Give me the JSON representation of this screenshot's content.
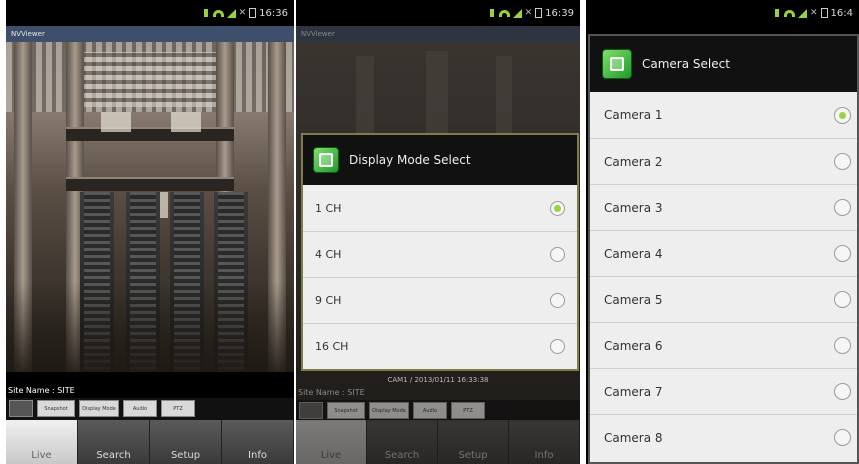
{
  "status": {
    "s1_time": "16:36",
    "s2_time": "16:39",
    "s3_time": "16:4"
  },
  "s1": {
    "app_title": "NVViewer",
    "site_name": "Site Name : SITE",
    "buttons": [
      "",
      "Snapshot",
      "Display Mode",
      "Audio",
      "PTZ"
    ],
    "tabs": [
      "Live",
      "Search",
      "Setup",
      "Info"
    ]
  },
  "s2": {
    "app_title": "NVViewer",
    "dialog_title": "Display Mode Select",
    "options": [
      "1 CH",
      "4 CH",
      "9 CH",
      "16 CH"
    ],
    "selected_index": 0,
    "cam_info": "CAM1 / 2013/01/11 16:33:38",
    "site_name": "Site Name : SITE",
    "buttons": [
      "",
      "Snapshot",
      "Display Mode",
      "Audio",
      "PTZ"
    ],
    "tabs": [
      "Live",
      "Search",
      "Setup",
      "Info"
    ]
  },
  "s3": {
    "dialog_title": "Camera Select",
    "options": [
      "Camera 1",
      "Camera 2",
      "Camera 3",
      "Camera 4",
      "Camera 5",
      "Camera 6",
      "Camera 7",
      "Camera 8"
    ],
    "selected_index": 0
  },
  "colors": {
    "accent_green": "#9ad23a",
    "title_bar": "#3d4f6b",
    "dialog_border": "#7d7d4a"
  }
}
